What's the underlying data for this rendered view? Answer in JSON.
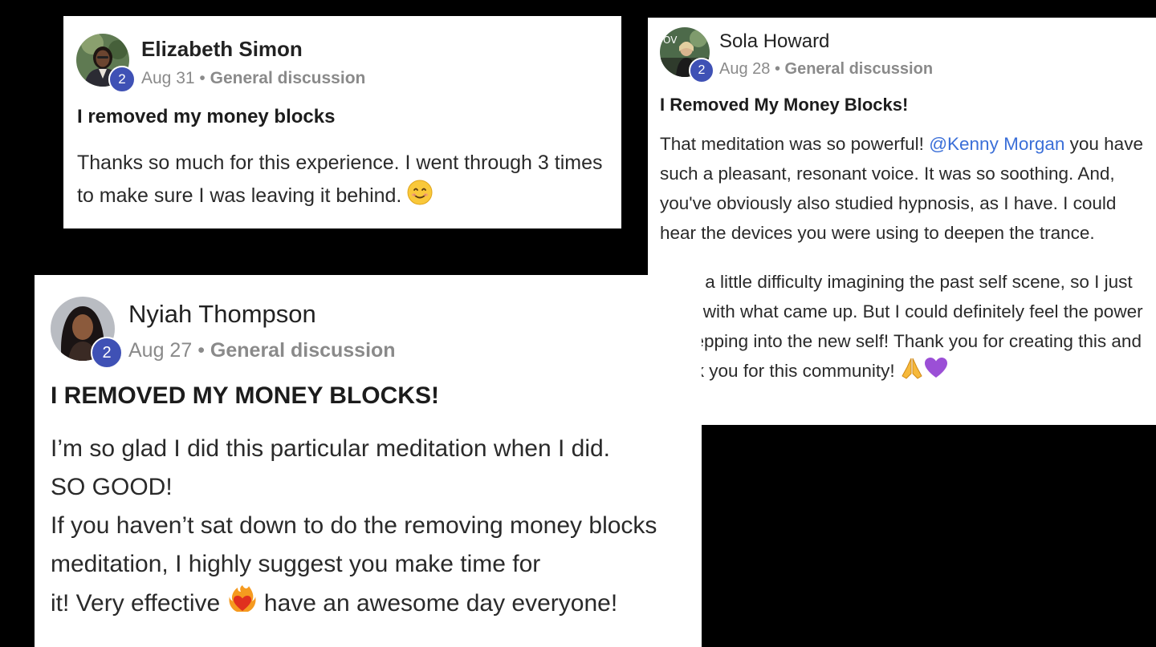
{
  "posts": [
    {
      "author": "Elizabeth Simon",
      "level": "2",
      "date": "Aug 31",
      "separator": "•",
      "category": "General discussion",
      "title": "I removed my money blocks",
      "body_1": "Thanks so much for this experience. I went through 3 times to make sure I was leaving it behind.",
      "emoji_1": "smiling-face-icon"
    },
    {
      "author": "Sola Howard",
      "level": "2",
      "date": "Aug 28",
      "separator": "•",
      "category": "General discussion",
      "title": "I Removed My Money Blocks!",
      "body_1_pre": "That meditation was so powerful!",
      "mention": "@Kenny Morgan",
      "body_1_post": "you have such a pleasant, resonant voice. It was so soothing. And, you've obviously also studied hypnosis, as I have. I could hear the devices you were using to deepen the trance.",
      "body_2": "I had a little difficulty imagining the past self scene, so I just went with what came up. But I could definitely feel the power of stepping into the new self! Thank you for creating this and thank you for this community!",
      "emoji_1": "folded-hands-icon",
      "emoji_2": "purple-heart-icon",
      "avatar_text": "OV",
      "mention_color": "#3b6fd8"
    },
    {
      "author": "Nyiah Thompson",
      "level": "2",
      "date": "Aug 27",
      "separator": "•",
      "category": "General discussion",
      "title": "I REMOVED MY MONEY BLOCKS!",
      "body_1": "I’m so glad I did this particular meditation when I did.",
      "body_2": "SO GOOD!",
      "body_3": "If you haven’t sat down to do the removing money blocks meditation, I highly suggest you make time for",
      "body_4_pre": "it! Very effective",
      "body_4_post": "have an awesome day everyone!",
      "emoji_1": "heart-on-fire-icon"
    }
  ],
  "colors": {
    "background": "#000000",
    "card": "#ffffff",
    "badge": "#3f51b5",
    "meta": "#8a8a8a"
  }
}
